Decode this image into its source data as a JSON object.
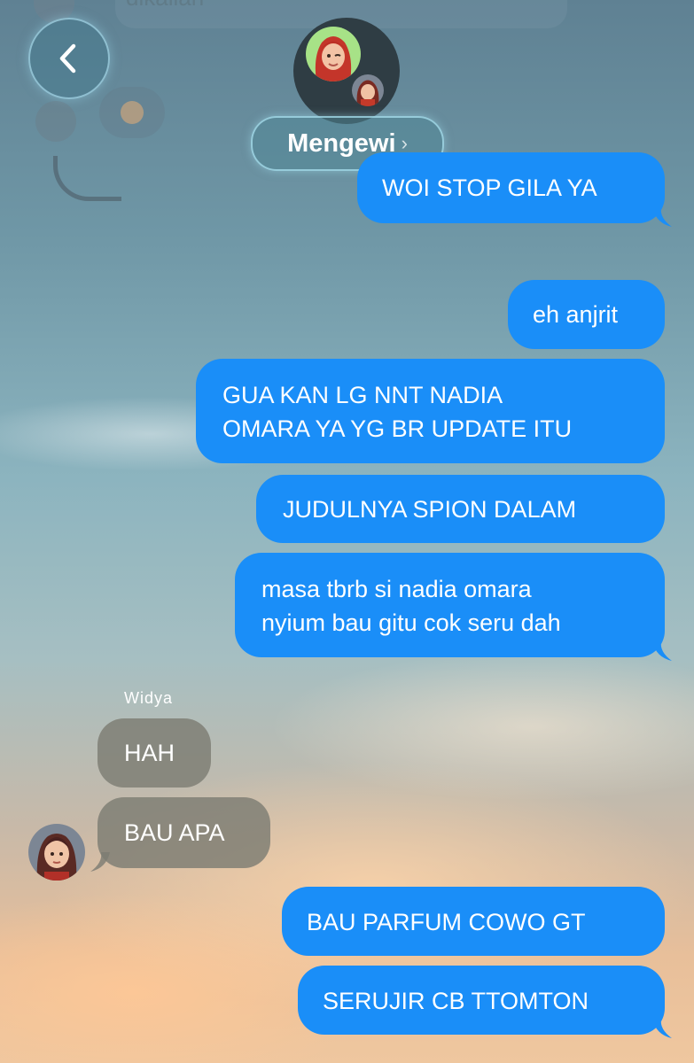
{
  "background_top_text": "dikalian",
  "header": {
    "group_name": "Mengewi",
    "back_icon": "chevron-left-icon",
    "accent_color": "#1a8ef8"
  },
  "messages": [
    {
      "direction": "out",
      "text": "WOI STOP GILA YA"
    },
    {
      "direction": "out",
      "text": "eh anjrit"
    },
    {
      "direction": "out",
      "lines": [
        "GUA KAN LG NNT NADIA",
        "OMARA YA YG BR UPDATE ITU"
      ]
    },
    {
      "direction": "out",
      "text": "JUDULNYA SPION DALAM"
    },
    {
      "direction": "out",
      "lines": [
        "masa tbrb si nadia omara",
        "nyium bau gitu cok seru dah"
      ]
    },
    {
      "direction": "in",
      "sender": "Widya",
      "text": "HAH"
    },
    {
      "direction": "in",
      "text": "BAU APA"
    },
    {
      "direction": "out",
      "text": "BAU PARFUM COWO GT"
    },
    {
      "direction": "out",
      "text": "SERUJIR CB TTOMTON"
    }
  ]
}
